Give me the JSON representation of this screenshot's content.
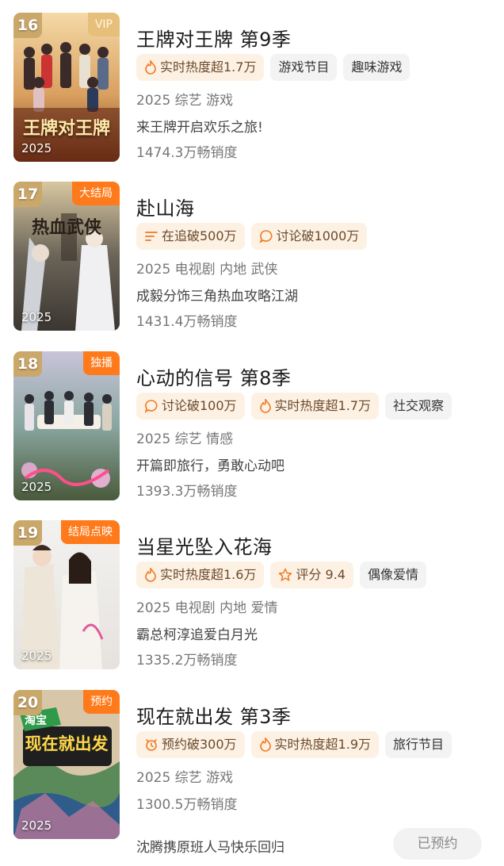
{
  "items": [
    {
      "rank": "16",
      "badge": "VIP",
      "poster_title": "王牌对王牌",
      "year": "2025",
      "title": "王牌对王牌 第9季",
      "tags": [
        "实时热度超1.7万",
        "游戏节目",
        "趣味游戏"
      ],
      "meta": "2025 综艺 游戏",
      "desc": "来王牌开启欢乐之旅!",
      "sales": "1474.3万畅销度"
    },
    {
      "rank": "17",
      "badge": "大结局",
      "poster_title": "热血武侠",
      "year": "2025",
      "title": "赴山海",
      "tags": [
        "在追破500万",
        "讨论破1000万"
      ],
      "meta": "2025 电视剧 内地 武侠",
      "desc": "成毅分饰三角热血攻略江湖",
      "sales": "1431.4万畅销度"
    },
    {
      "rank": "18",
      "badge": "独播",
      "year": "2025",
      "title": "心动的信号 第8季",
      "tags": [
        "讨论破100万",
        "实时热度超1.7万",
        "社交观察"
      ],
      "meta": "2025 综艺 情感",
      "desc": "开篇即旅行，勇敢心动吧",
      "sales": "1393.3万畅销度"
    },
    {
      "rank": "19",
      "badge": "结局点映",
      "year": "2025",
      "title": "当星光坠入花海",
      "tags": [
        "实时热度超1.6万",
        "评分 9.4",
        "偶像爱情"
      ],
      "meta": "2025 电视剧 内地 爱情",
      "desc": "霸总柯淳追爱白月光",
      "sales": "1335.2万畅销度"
    },
    {
      "rank": "20",
      "badge": "预约",
      "poster_title": "现在就出发",
      "poster_subtitle": "淘宝",
      "year": "2025",
      "title": "现在就出发 第3季",
      "tags": [
        "预约破300万",
        "实时热度超1.9万",
        "旅行节目"
      ],
      "meta": "2025 综艺 游戏",
      "sales": "1300.5万畅销度",
      "desc": "沈腾携原班人马快乐回归",
      "button": "已预约"
    }
  ],
  "colors": {
    "accent": "#ff7a1a",
    "tag_bg": "#fdf1e4",
    "rank_bg": "#caa86a"
  }
}
